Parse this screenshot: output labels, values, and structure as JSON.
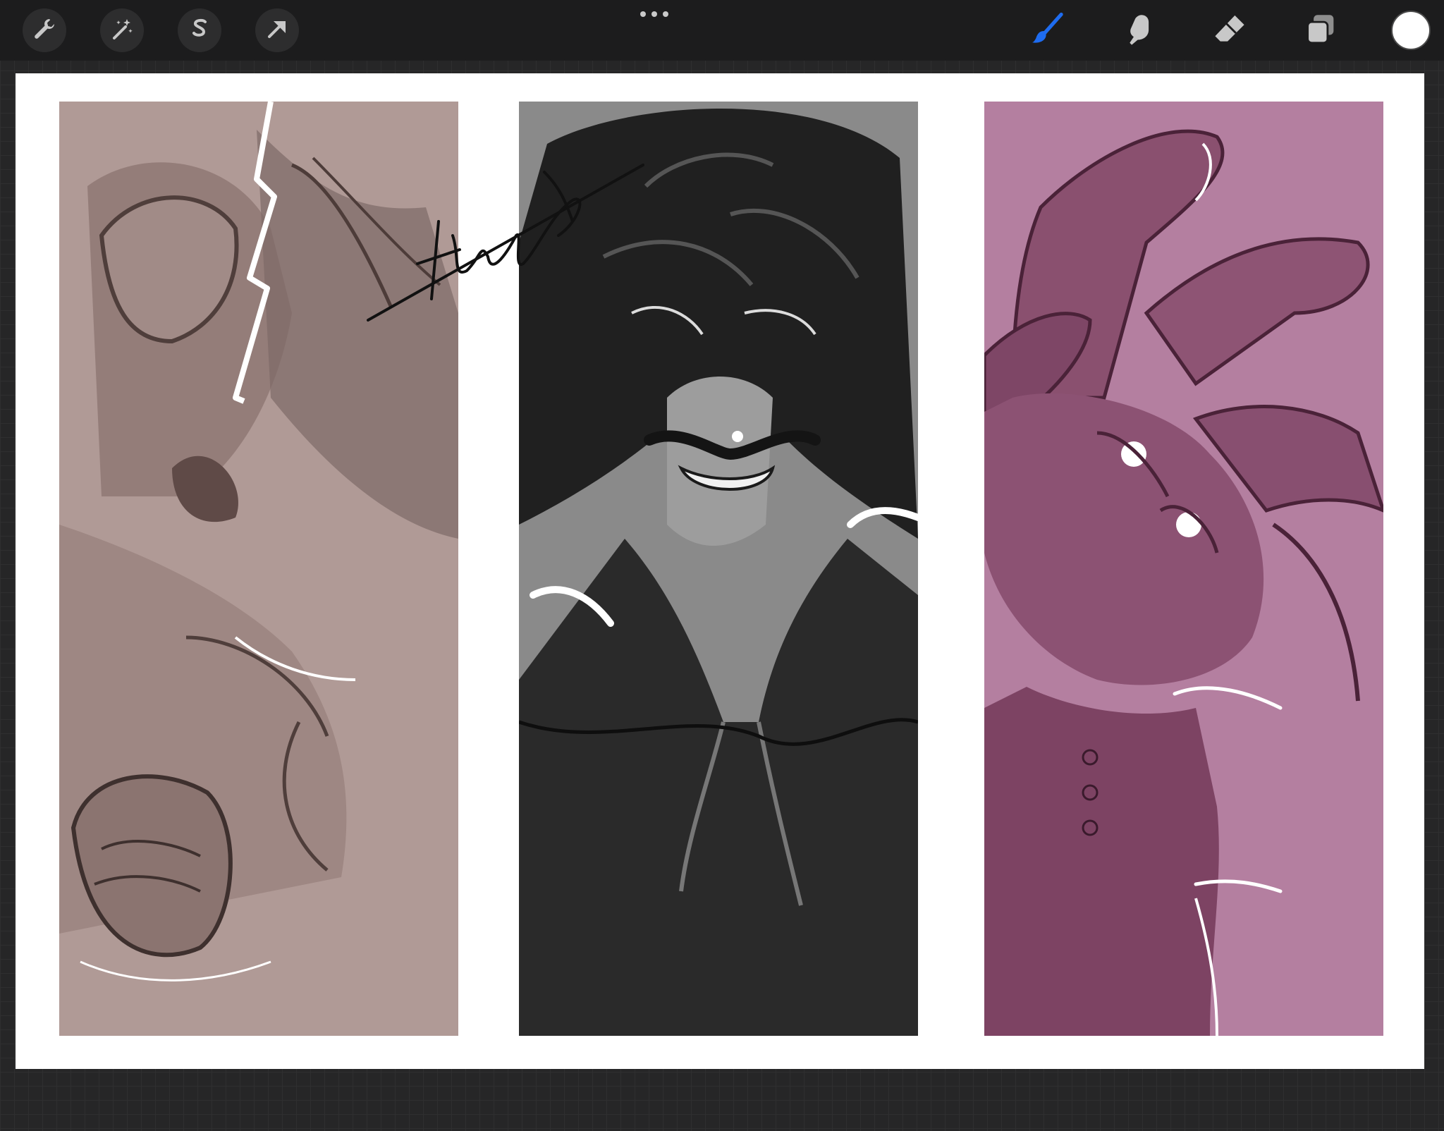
{
  "toolbar": {
    "left_tools": [
      {
        "name": "actions",
        "icon": "wrench-icon"
      },
      {
        "name": "adjustments",
        "icon": "magic-wand-icon"
      },
      {
        "name": "selection",
        "icon": "selection-s-icon"
      },
      {
        "name": "transform",
        "icon": "arrow-cursor-icon"
      }
    ],
    "more_icon": "more-dots-icon",
    "right_tools": [
      {
        "name": "brush",
        "icon": "brush-icon",
        "active": true
      },
      {
        "name": "smudge",
        "icon": "smudge-finger-icon"
      },
      {
        "name": "eraser",
        "icon": "eraser-icon"
      },
      {
        "name": "layers",
        "icon": "layers-icon"
      }
    ],
    "current_color": "#ffffff",
    "active_color": "#1e6cf0"
  },
  "canvas": {
    "background": "#ffffff",
    "panels": [
      {
        "name": "panel-1",
        "subject": "helmeted-warrior",
        "background": "#b09a96"
      },
      {
        "name": "panel-2",
        "subject": "wild-haired-grin",
        "background": "#8a8a8a"
      },
      {
        "name": "panel-3",
        "subject": "clawed-hand",
        "background": "#b47fa0"
      }
    ]
  }
}
